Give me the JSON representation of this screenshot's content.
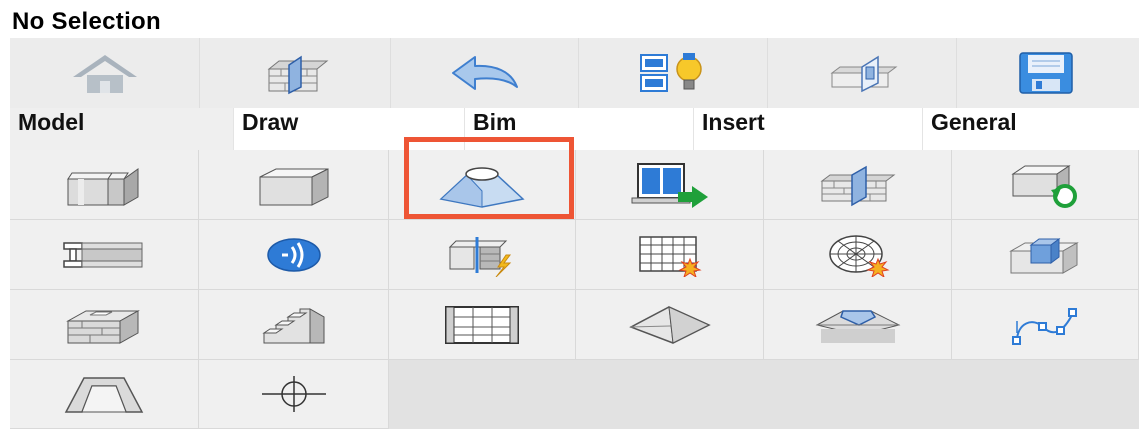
{
  "header": {
    "title": "No Selection"
  },
  "toolbar": {
    "buttons": [
      {
        "icon": "home-icon"
      },
      {
        "icon": "wall-window-icon"
      },
      {
        "icon": "undo-arrow-icon"
      },
      {
        "icon": "layers-bulb-icon"
      },
      {
        "icon": "wall-panel-icon"
      },
      {
        "icon": "save-disk-icon"
      }
    ]
  },
  "tabs": [
    {
      "label": "Model",
      "active": true
    },
    {
      "label": "Draw",
      "active": false
    },
    {
      "label": "Bim",
      "active": false
    },
    {
      "label": "Insert",
      "active": false
    },
    {
      "label": "General",
      "active": false
    }
  ],
  "tools": [
    {
      "icon": "l-wall-icon"
    },
    {
      "icon": "box-solid-icon"
    },
    {
      "icon": "frustum-icon",
      "highlighted": true
    },
    {
      "icon": "window-insert-icon"
    },
    {
      "icon": "wall-opening-icon"
    },
    {
      "icon": "rotate-solid-icon"
    },
    {
      "icon": "beam-profile-icon"
    },
    {
      "icon": "signal-icon"
    },
    {
      "icon": "wall-split-icon"
    },
    {
      "icon": "grid-explode-icon"
    },
    {
      "icon": "radial-grid-explode-icon"
    },
    {
      "icon": "box-intersect-icon"
    },
    {
      "icon": "slab-layers-icon"
    },
    {
      "icon": "stairs-icon"
    },
    {
      "icon": "curtain-wall-icon"
    },
    {
      "icon": "pyramid-roof-icon"
    },
    {
      "icon": "hip-roof-icon"
    },
    {
      "icon": "spline-icon"
    },
    {
      "icon": "channel-profile-icon"
    },
    {
      "icon": "crosshair-icon"
    }
  ],
  "colors": {
    "highlight": "#ee5535",
    "accent_blue": "#2e7bd6",
    "accent_green": "#1fa03a"
  }
}
